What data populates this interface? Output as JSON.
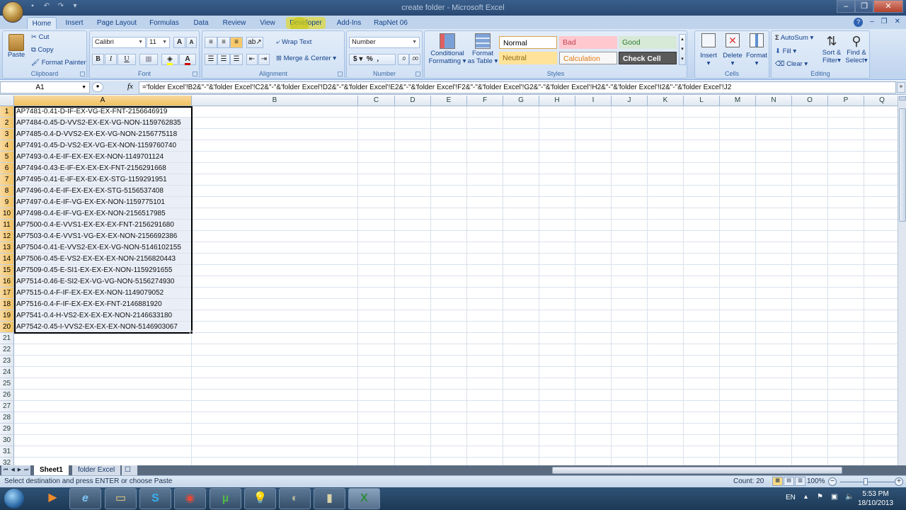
{
  "window": {
    "title": "create folder - Microsoft Excel",
    "controls": [
      "minimize",
      "restore",
      "close"
    ]
  },
  "ribbon_tabs": [
    {
      "label": "Home",
      "active": true
    },
    {
      "label": "Insert"
    },
    {
      "label": "Page Layout"
    },
    {
      "label": "Formulas"
    },
    {
      "label": "Data"
    },
    {
      "label": "Review"
    },
    {
      "label": "View"
    },
    {
      "label": "Developer",
      "highlighted": true
    },
    {
      "label": "Add-Ins"
    },
    {
      "label": "RapNet 06"
    }
  ],
  "clipboard": {
    "group_label": "Clipboard",
    "paste": "Paste",
    "cut": "Cut",
    "copy": "Copy",
    "format_painter": "Format Painter"
  },
  "font": {
    "group_label": "Font",
    "font_name": "Calibri",
    "font_size": "11",
    "bold": "B",
    "italic": "I",
    "underline": "U",
    "grow": "A",
    "shrink": "A",
    "fill_color": "#ffff00",
    "font_color": "#cc0000"
  },
  "alignment": {
    "group_label": "Alignment",
    "wrap_text": "Wrap Text",
    "merge_center": "Merge & Center"
  },
  "number": {
    "group_label": "Number",
    "format": "Number",
    "currency": "$",
    "percent": "%",
    "comma": ","
  },
  "styles": {
    "group_label": "Styles",
    "conditional_formatting": "Conditional",
    "conditional_formatting_2": "Formatting",
    "format_as_table": "Format",
    "format_as_table_2": "as Table",
    "cells": [
      {
        "label": "Normal",
        "bg": "#ffffff",
        "color": "#000000"
      },
      {
        "label": "Bad",
        "bg": "#ffc7ce",
        "color": "#9c0006"
      },
      {
        "label": "Good",
        "bg": "#c6efce",
        "color": "#006100"
      },
      {
        "label": "Neutral",
        "bg": "#ffeb9c",
        "color": "#9c6500"
      },
      {
        "label": "Calculation",
        "bg": "#f2f2f2",
        "color": "#fa7d00"
      },
      {
        "label": "Check Cell",
        "bg": "#595959",
        "color": "#ffffff"
      }
    ]
  },
  "cells_group": {
    "group_label": "Cells",
    "insert": "Insert",
    "delete": "Delete",
    "format": "Format"
  },
  "editing": {
    "group_label": "Editing",
    "autosum": "AutoSum",
    "fill": "Fill",
    "clear": "Clear",
    "sort_filter": "Sort &",
    "sort_filter_2": "Filter",
    "find_select": "Find &",
    "find_select_2": "Select"
  },
  "formula_bar": {
    "name_box": "A1",
    "fx": "fx",
    "formula": "='folder Excel'!B2&\"-\"&'folder Excel'!C2&\"-\"&'folder Excel'!D2&\"-\"&'folder Excel'!E2&\"-\"&'folder Excel'!F2&\"-\"&'folder Excel'!G2&\"-\"&'folder Excel'!H2&\"-\"&'folder Excel'!I2&\"-\"&'folder Excel'!J2"
  },
  "grid": {
    "columns": [
      "A",
      "B",
      "C",
      "D",
      "E",
      "F",
      "G",
      "H",
      "I",
      "J",
      "K",
      "L",
      "M",
      "N",
      "O",
      "P",
      "Q"
    ],
    "selected_column": "A",
    "row_numbers": [
      "1",
      "2",
      "3",
      "4",
      "5",
      "6",
      "7",
      "8",
      "9",
      "10",
      "11",
      "12",
      "13",
      "14",
      "15",
      "16",
      "17",
      "18",
      "19",
      "20",
      "21",
      "22",
      "23",
      "24",
      "25",
      "26",
      "27",
      "28",
      "29",
      "30",
      "31",
      "32"
    ],
    "column_a_values": [
      "AP7481-0.41-D-IF-EX-VG-EX-FNT-2156646919",
      "AP7484-0.45-D-VVS2-EX-EX-VG-NON-1159762835",
      "AP7485-0.4-D-VVS2-EX-EX-VG-NON-2156775118",
      "AP7491-0.45-D-VS2-EX-VG-EX-NON-1159760740",
      "AP7493-0.4-E-IF-EX-EX-EX-NON-1149701124",
      "AP7494-0.43-E-IF-EX-EX-EX-FNT-2156291668",
      "AP7495-0.41-E-IF-EX-EX-EX-STG-1159291951",
      "AP7496-0.4-E-IF-EX-EX-EX-STG-5156537408",
      "AP7497-0.4-E-IF-VG-EX-EX-NON-1159775101",
      "AP7498-0.4-E-IF-VG-EX-EX-NON-2156517985",
      "AP7500-0.4-E-VVS1-EX-EX-EX-FNT-2156291680",
      "AP7503-0.4-E-VVS1-VG-EX-EX-NON-2156692386",
      "AP7504-0.41-E-VVS2-EX-EX-VG-NON-5146102155",
      "AP7506-0.45-E-VS2-EX-EX-EX-NON-2156820443",
      "AP7509-0.45-E-SI1-EX-EX-EX-NON-1159291655",
      "AP7514-0.46-E-SI2-EX-VG-VG-NON-5156274930",
      "AP7515-0.4-F-IF-EX-EX-EX-NON-1149079052",
      "AP7516-0.4-F-IF-EX-EX-EX-FNT-2146881920",
      "AP7541-0.4-H-VS2-EX-EX-EX-NON-2146633180",
      "AP7542-0.45-I-VVS2-EX-EX-EX-NON-5146903067"
    ]
  },
  "sheets": [
    {
      "label": "Sheet1",
      "active": true
    },
    {
      "label": "folder Excel"
    }
  ],
  "status_bar": {
    "message": "Select destination and press ENTER or choose Paste",
    "count": "Count: 20",
    "zoom": "100%",
    "zoom_minus": "−",
    "zoom_plus": "+"
  },
  "taskbar": {
    "apps": [
      "windows-media-player",
      "internet-explorer",
      "windows-explorer",
      "skype",
      "chrome",
      "utorrent",
      "lightbulb-app",
      "app-8",
      "app-9",
      "excel"
    ],
    "language": "EN",
    "time": "5:53 PM",
    "date": "18/10/2013"
  }
}
